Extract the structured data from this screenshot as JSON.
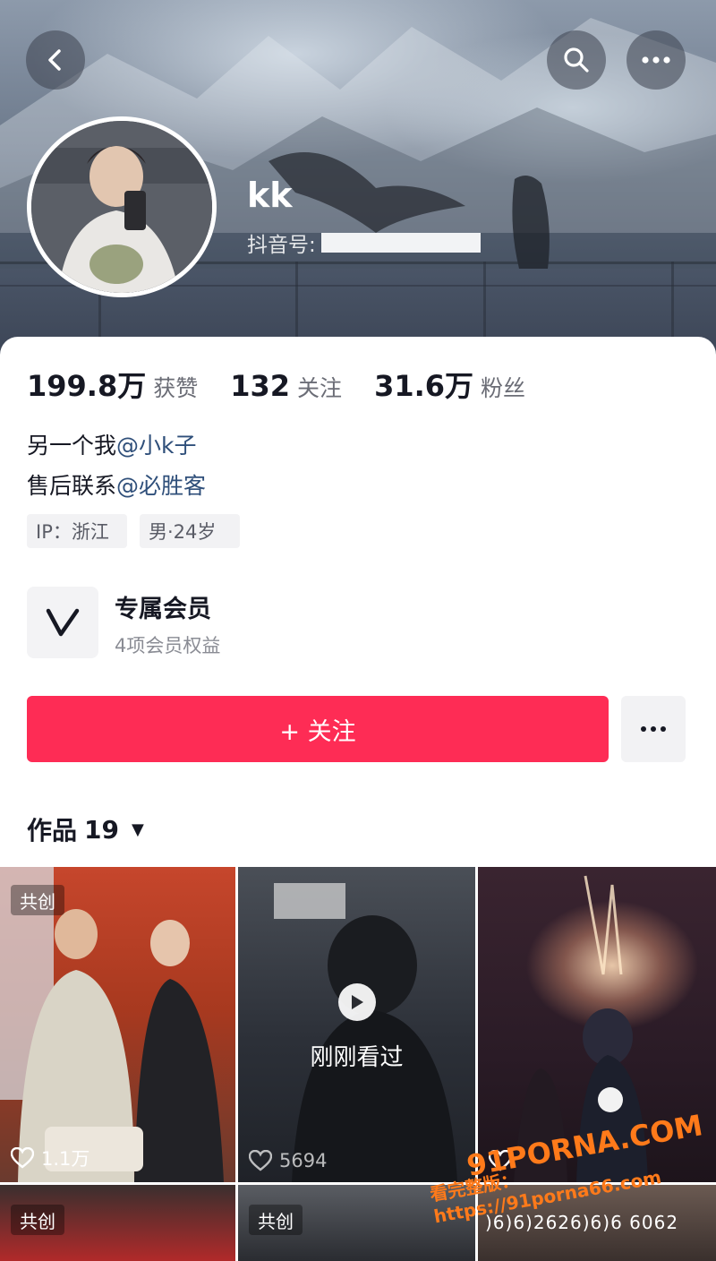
{
  "header": {
    "username": "kk",
    "douyin_id_label": "抖音号:"
  },
  "stats": [
    {
      "value": "199.8万",
      "label": "获赞"
    },
    {
      "value": "132",
      "label": "关注"
    },
    {
      "value": "31.6万",
      "label": "粉丝"
    }
  ],
  "bio": {
    "line1_prefix": "另一个我",
    "line1_mention": "@小k子",
    "line2_prefix": "售后联系",
    "line2_mention": "@必胜客"
  },
  "tags": {
    "ip": "IP：浙江",
    "gender_age": "男·24岁"
  },
  "membership": {
    "title": "专属会员",
    "subtitle": "4项会员权益",
    "icon_letter": "V"
  },
  "actions": {
    "follow_label": "+ 关注"
  },
  "works": {
    "label": "作品",
    "count": "19"
  },
  "grid": [
    {
      "badge": "共创",
      "likes": "1.1万"
    },
    {
      "overlay": "刚刚看过",
      "likes": "5694"
    },
    {
      "likes": ""
    },
    {
      "badge": "共创"
    },
    {
      "badge": "共创"
    },
    {
      "text": ")6)6)2626)6)6 6062"
    }
  ],
  "watermark": {
    "logo": "91PORNA.COM",
    "text": "看完整版：https://91porna66.com"
  },
  "colors": {
    "accent": "#fe2c55",
    "mention": "#2f4f7a"
  }
}
